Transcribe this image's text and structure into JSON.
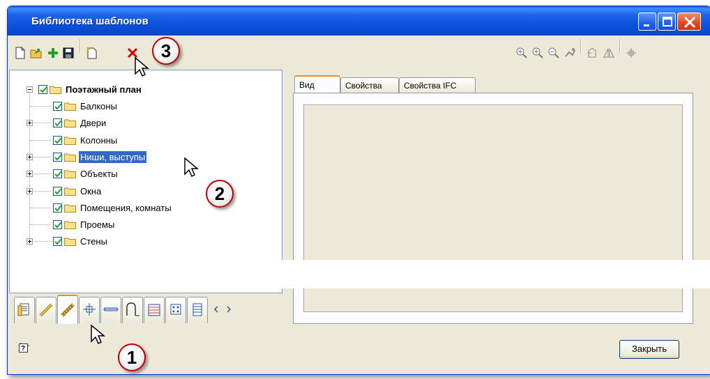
{
  "window": {
    "title": "Библиотека шаблонов"
  },
  "tree": {
    "root": "Поэтажный план",
    "items": [
      {
        "label": "Балконы",
        "expandable": false
      },
      {
        "label": "Двери",
        "expandable": true
      },
      {
        "label": "Колонны",
        "expandable": false
      },
      {
        "label": "Ниши, выступы",
        "expandable": true,
        "selected": true
      },
      {
        "label": "Объекты",
        "expandable": true
      },
      {
        "label": "Окна",
        "expandable": true
      },
      {
        "label": "Помещения, комнаты",
        "expandable": false
      },
      {
        "label": "Проемы",
        "expandable": false
      },
      {
        "label": "Стены",
        "expandable": true
      }
    ]
  },
  "tabs": {
    "view": "Вид",
    "properties": "Свойства",
    "ifc": "Свойства IFC"
  },
  "buttons": {
    "close": "Закрыть"
  },
  "callouts": {
    "one": "1",
    "two": "2",
    "three": "3"
  },
  "colors": {
    "title_bar": "#0a4fd8",
    "selection": "#316ac5",
    "checkmark": "#21a121",
    "delete": "#d40000",
    "callout_border": "#c00000"
  }
}
